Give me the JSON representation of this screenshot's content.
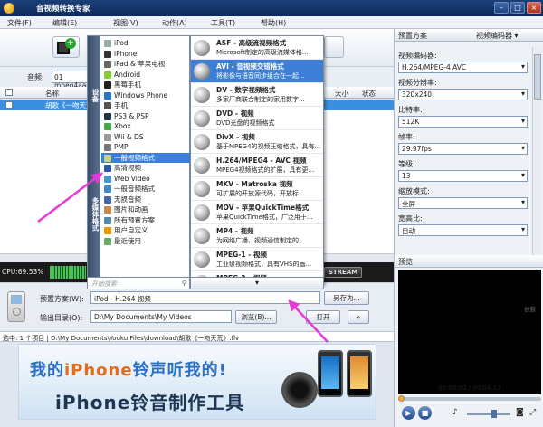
{
  "app": {
    "title": "音视频转换专家"
  },
  "window_buttons": {
    "minimize": "–",
    "restore": "□",
    "close": "×"
  },
  "menubar": {
    "file": "文件(F)",
    "edit": "编辑(E)",
    "view": "视图(V)",
    "action": "动作(A)",
    "tools": "工具(T)",
    "help": "帮助(H)"
  },
  "audio": {
    "label": "音频:",
    "value": "01 mpeg4aac"
  },
  "list": {
    "columns": {
      "name": "名称",
      "size": "大小",
      "status": "状态"
    },
    "rows": [
      {
        "name": "胡歌《一吻天荒》"
      }
    ]
  },
  "status": {
    "cpu": "CPU:69.53%",
    "stream_label": "STREAM"
  },
  "format_menu": {
    "side_labels": [
      "设备",
      "多媒体格式"
    ],
    "items": [
      "iPod",
      "iPhone",
      "iPad & 苹果电视",
      "Android",
      "黑莓手机",
      "Windows Phone",
      "手机",
      "PS3 & PSP",
      "Xbox",
      "Wii & DS",
      "PMP",
      "一般视频格式",
      "高清视频",
      "Web Video",
      "一般音频格式",
      "无损音频",
      "图片和动画",
      "所有预置方案",
      "用户自定义",
      "最近使用"
    ],
    "active_index": 11
  },
  "format_submenu": {
    "items": [
      {
        "title": "ASF - 高级流视频格式",
        "desc": "Microsoft制定的高级流媒体格..."
      },
      {
        "title": "AVI - 音视频交错格式",
        "desc": "将影像与语音同步组合在一起..."
      },
      {
        "title": "DV - 数字视频格式",
        "desc": "多家厂商联合制定的家用数字..."
      },
      {
        "title": "DVD - 视频",
        "desc": "DVD光盘的视频格式"
      },
      {
        "title": "DivX - 视频",
        "desc": "基于MPEG4的视频压缩格式，具有..."
      },
      {
        "title": "H.264/MPEG4 - AVC 视频",
        "desc": "MPEG4视频格式的扩展，具有更..."
      },
      {
        "title": "MKV - Matroska 视频",
        "desc": "可扩展的开放源代码，开放标..."
      },
      {
        "title": "MOV - 苹果QuickTime格式",
        "desc": "苹果QuickTime格式，广泛用于..."
      },
      {
        "title": "MP4 - 视频",
        "desc": "为网络广播、视频通信制定的..."
      },
      {
        "title": "MPEG-1 - 视频",
        "desc": "工业级视频格式，具有VHS的画..."
      },
      {
        "title": "MPEG-2 - 视频",
        "desc": ""
      }
    ],
    "active_index": 1
  },
  "menu_search": {
    "placeholder": "开始搜索",
    "icon": "magnifier-icon",
    "glyph": "⚲"
  },
  "menu_more": {
    "glyph": "▾"
  },
  "preset": {
    "label": "预置方案(W):",
    "value": "iPod - H.264 视频",
    "save_as": "另存为...",
    "icon": "ipod-icon"
  },
  "output": {
    "label": "输出目录(O):",
    "value": "D:\\My Documents\\My Videos",
    "browse": "浏览(B)...",
    "open": "打开"
  },
  "selection_bar": {
    "text": "选中: 1 个项目 | D:\\My Documents\\Youku Files\\download\\胡歌《一吻天荒》.flv"
  },
  "banner": {
    "line1_a": "我的",
    "line1_b": "iPhone",
    "line1_c": "铃声听我的!",
    "line2": "iPhone铃音制作工具"
  },
  "settings": {
    "header": "预置方案",
    "selector": "视频编码器 ▾",
    "fields": [
      {
        "label": "视频编码器:",
        "value": "H.264/MPEG-4 AVC"
      },
      {
        "label": "视频分辨率:",
        "value": "320x240"
      },
      {
        "label": "比特率:",
        "value": "512K"
      },
      {
        "label": "帧率:",
        "value": "29.97fps"
      },
      {
        "label": "等级:",
        "value": "13"
      },
      {
        "label": "缩放模式:",
        "value": "全屏"
      },
      {
        "label": "宽高比:",
        "value": "自动"
      }
    ]
  },
  "preview": {
    "header": "预览",
    "overlay": "依服",
    "time": "00:00:00 / 00:04:13",
    "progress": 0.0,
    "volume": 0.65,
    "play_glyph": "▶",
    "stop_glyph": "■"
  },
  "colors": {
    "accent": "#3d7fd6",
    "arrow": "#e53ad8"
  }
}
